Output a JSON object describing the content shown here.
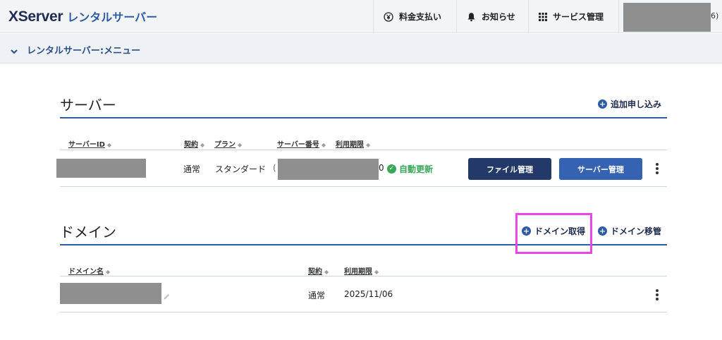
{
  "header": {
    "logo_main": "XServer",
    "logo_sub": "レンタルサーバー",
    "nav": {
      "payment": "料金支払い",
      "news": "お知らせ",
      "services": "サービス管理"
    },
    "user_suffix": "6)"
  },
  "subheader": {
    "title": "レンタルサーバー:メニュー"
  },
  "server_section": {
    "title": "サーバー",
    "add_action": "追加申し込み",
    "columns": [
      "サーバーID",
      "契約",
      "プラン",
      "サーバー番号",
      "利用期限"
    ],
    "rows": [
      {
        "contract": "通常",
        "plan": "スタンダード",
        "partial_prefix": "(",
        "partial_suffix": "0",
        "auto_renew": "自動更新",
        "file_button": "ファイル管理",
        "server_button": "サーバー管理"
      }
    ]
  },
  "domain_section": {
    "title": "ドメイン",
    "acquire_action": "ドメイン取得",
    "transfer_action": "ドメイン移管",
    "columns": [
      "ドメイン名",
      "契約",
      "利用期限"
    ],
    "rows": [
      {
        "contract": "通常",
        "expiry": "2025/11/06"
      }
    ]
  },
  "colors": {
    "brand_dark": "#1f2c55",
    "brand_blue": "#2d5ba6",
    "section_line": "#2f5d9c",
    "success": "#3aa657",
    "highlight": "#ea48e6"
  },
  "icons": {
    "payment": "yen-circle-icon",
    "news": "bell-icon",
    "services": "grid-icon",
    "subheader": "chevron-down-icon",
    "add": "plus-circle-icon",
    "renew": "check-circle-icon",
    "sort": "sort-icon",
    "edit": "pencil-icon",
    "menu": "kebab-icon"
  }
}
